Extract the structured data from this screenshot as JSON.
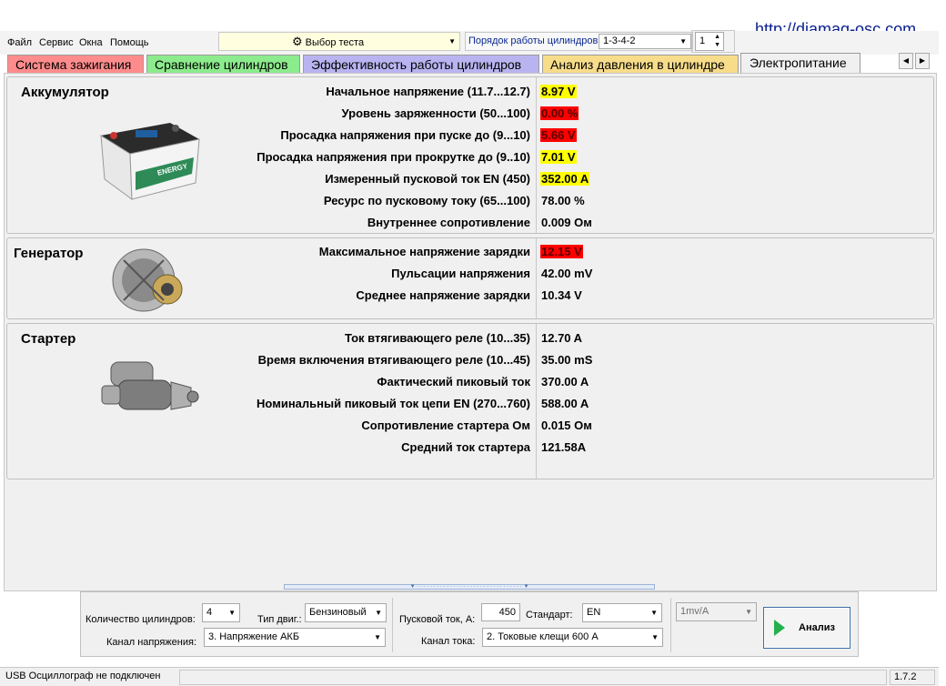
{
  "watermark_url": "http://diamag-osc.com",
  "menu": [
    "Файл",
    "Сервис",
    "Окна",
    "Помощь"
  ],
  "toolbar": {
    "test_select": "Выбор теста",
    "order_label": "Порядок работы цилиндров",
    "order_value": "1-3-4-2",
    "spin_value": "1"
  },
  "tabs": [
    {
      "label": "Система зажигания",
      "color": "#ff8c8c"
    },
    {
      "label": "Сравнение цилиндров",
      "color": "#8ceb8c"
    },
    {
      "label": "Эффективность работы цилиндров",
      "color": "#b9b4f0"
    },
    {
      "label": "Анализ давления в цилиндре",
      "color": "#f7dc8a"
    },
    {
      "label": "Электропитание",
      "color": "#f0f0f0"
    }
  ],
  "sections": {
    "battery": {
      "title": "Аккумулятор",
      "image_text": "ENERGY",
      "rows": [
        {
          "label": "Начальное напряжение (11.7...12.7)",
          "value": "8.97 V",
          "hl": "yellow"
        },
        {
          "label": "Уровень заряженности (50...100)",
          "value": "0.00 %",
          "hl": "red"
        },
        {
          "label": "Просадка напряжения при пуске до (9...10)",
          "value": "5.66 V",
          "hl": "red"
        },
        {
          "label": "Просадка напряжения при прокрутке до  (9..10)",
          "value": "7.01 V",
          "hl": "yellow"
        },
        {
          "label": "Измеренный пусковой ток  EN (450)",
          "value": "352.00 A",
          "hl": "yellow"
        },
        {
          "label": "Ресурс по пусковому току (65...100)",
          "value": "78.00 %",
          "hl": ""
        },
        {
          "label": "Внутреннее сопротивление",
          "value": "0.009 Ом",
          "hl": ""
        }
      ]
    },
    "generator": {
      "title": "Генератор",
      "rows": [
        {
          "label": "Максимальное напряжение зарядки",
          "value": "12.15 V",
          "hl": "red"
        },
        {
          "label": "Пульсации напряжения",
          "value": "42.00 mV",
          "hl": ""
        },
        {
          "label": "Среднее напряжение зарядки",
          "value": "10.34 V",
          "hl": ""
        }
      ]
    },
    "starter": {
      "title": "Стартер",
      "rows": [
        {
          "label": "Ток втягивающего реле (10...35)",
          "value": "12.70 A",
          "hl": ""
        },
        {
          "label": "Время включения втягивающего реле (10...45)",
          "value": "35.00 mS",
          "hl": ""
        },
        {
          "label": "Фактический пиковый ток",
          "value": "370.00 A",
          "hl": ""
        },
        {
          "label": "Номинальный пиковый ток цепи EN (270...760)",
          "value": "588.00 A",
          "hl": ""
        },
        {
          "label": "Сопротивление стартера Ом",
          "value": "0.015 Ом",
          "hl": ""
        },
        {
          "label": "Средний ток стартера",
          "value": "121.58A",
          "hl": ""
        }
      ]
    }
  },
  "controls": {
    "cylinders_label": "Количество цилиндров:",
    "cylinders_value": "4",
    "engine_type_label": "Тип двиг.:",
    "engine_type_value": "Бензиновый",
    "voltage_channel_label": "Канал напряжения:",
    "voltage_channel_value": "3.  Напряжение АКБ",
    "start_current_label": "Пусковой ток, А:",
    "start_current_value": "450",
    "standard_label": "Стандарт:",
    "standard_value": "EN",
    "current_channel_label": "Канал тока:",
    "current_channel_value": "2.  Токовые клещи 600 А",
    "sensitivity_value": "1mv/A",
    "analyze_label": "Анализ"
  },
  "status": {
    "connection": "USB Осциллограф не подключен",
    "version": "1.7.2"
  }
}
